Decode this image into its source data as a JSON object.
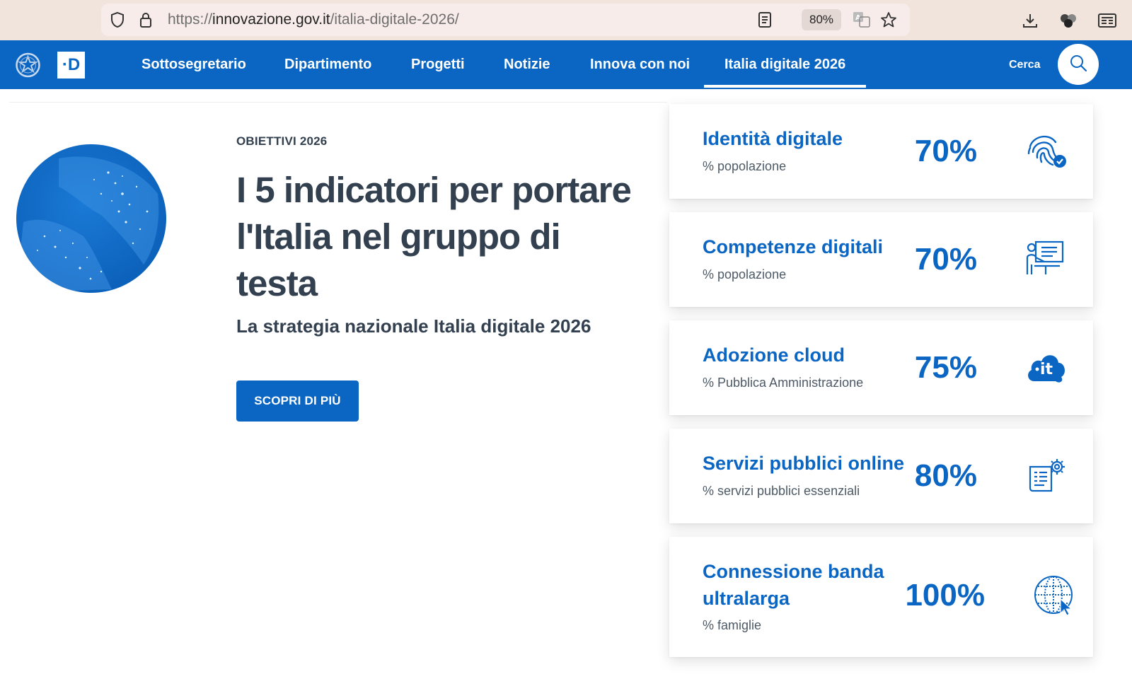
{
  "browser": {
    "url_scheme": "https://",
    "url_host": "innovazione.gov.it",
    "url_path": "/italia-digitale-2026/",
    "zoom": "80%"
  },
  "nav": {
    "items": [
      "Sottosegretario",
      "Dipartimento",
      "Progetti",
      "Notizie",
      "Innova con noi",
      "Italia digitale 2026"
    ],
    "active_index": 5,
    "logo_text": "·D",
    "search_label": "Cerca"
  },
  "hero": {
    "eyebrow": "OBIETTIVI 2026",
    "title": "I 5 indicatori per portare l'Italia nel gruppo di testa",
    "subtitle": "La strategia nazionale Italia digitale 2026",
    "cta": "SCOPRI DI PIÙ"
  },
  "indicators": [
    {
      "title": "Identità digitale",
      "subtitle": "% popolazione",
      "value": "70%",
      "icon": "fingerprint-icon"
    },
    {
      "title": "Competenze digitali",
      "subtitle": "% popolazione",
      "value": "70%",
      "icon": "presentation-icon"
    },
    {
      "title": "Adozione cloud",
      "subtitle": "% Pubblica Amministrazione",
      "value": "75%",
      "icon": "cloud-it-icon"
    },
    {
      "title": "Servizi pubblici online",
      "subtitle": "% servizi pubblici essenziali",
      "value": "80%",
      "icon": "document-gear-icon"
    },
    {
      "title": "Connessione banda ultralarga",
      "subtitle": "% famiglie",
      "value": "100%",
      "icon": "globe-cursor-icon"
    }
  ],
  "colors": {
    "brand_blue": "#0b66c3",
    "text_dark": "#33404f"
  }
}
